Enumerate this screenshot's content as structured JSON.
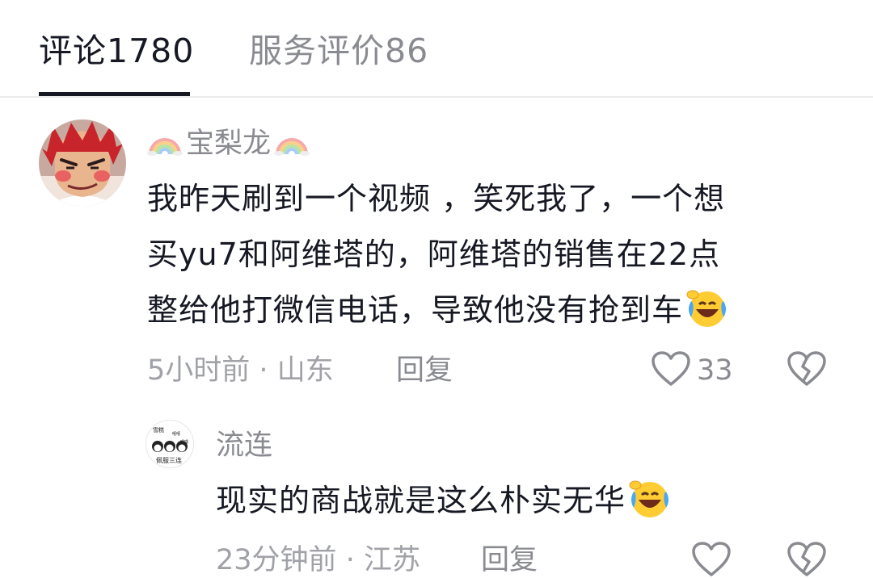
{
  "tabs": {
    "comments_label": "评论",
    "comments_count": "1780",
    "reviews_label": "服务评价",
    "reviews_count": "86",
    "active": "comments"
  },
  "comments": [
    {
      "username": "宝梨龙",
      "username_decoration": "rainbow-icon",
      "text_lines": [
        "我昨天刷到一个视频 ，笑死我了，一个想",
        "买yu7和阿维塔的，阿维塔的销售在22点",
        "整给他打微信电话，导致他没有抢到车"
      ],
      "emoji": "laughing-crying-emoji",
      "time": "5小时前",
      "separator": "·",
      "location": "山东",
      "reply_label": "回复",
      "like_count": "33"
    },
    {
      "username": "流连",
      "avatar_text": [
        "雪糕",
        "嘻嘻",
        "嘿嘿",
        "佩服三连"
      ],
      "text": "现实的商战就是这么朴实无华",
      "emoji": "laughing-crying-emoji",
      "time": "23分钟前",
      "separator": "·",
      "location": "江苏",
      "reply_label": "回复"
    }
  ],
  "colors": {
    "primary_text": "#161823",
    "secondary_text": "#8a8b91",
    "tertiary_text": "#a1a2a7",
    "divider": "#ececec"
  }
}
